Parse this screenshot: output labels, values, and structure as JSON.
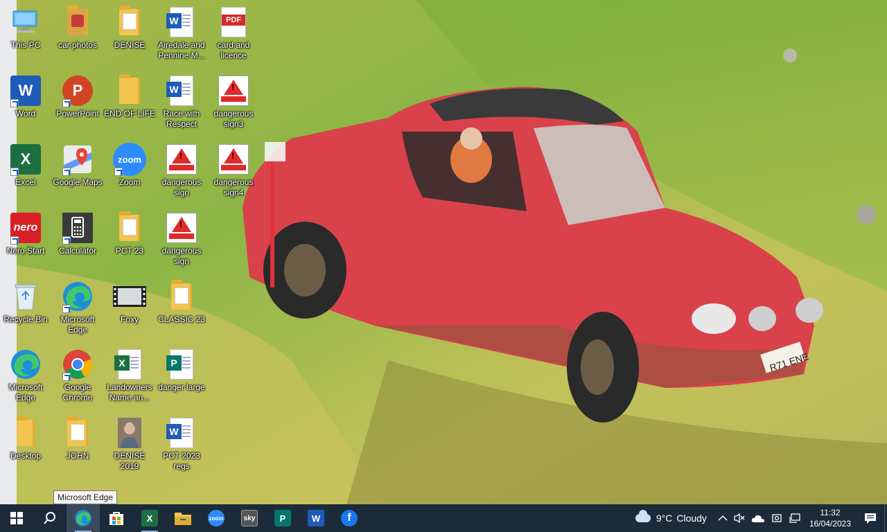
{
  "desktop": {
    "icons": [
      {
        "label": "This PC"
      },
      {
        "label": "car photos"
      },
      {
        "label": "DENISE"
      },
      {
        "label": "Airedale and Pennine M..."
      },
      {
        "label": "card and licence"
      },
      {
        "label": "Word"
      },
      {
        "label": "PowerPoint"
      },
      {
        "label": "END OF LIFE"
      },
      {
        "label": "Race with Respect"
      },
      {
        "label": "dangerous sign3"
      },
      {
        "label": "Excel"
      },
      {
        "label": "Google Maps"
      },
      {
        "label": "Zoom"
      },
      {
        "label": "dangerous sign"
      },
      {
        "label": "dangerous sign4"
      },
      {
        "label": "Nero Start"
      },
      {
        "label": "Calculator"
      },
      {
        "label": "PCT 23"
      },
      {
        "label": "dangerous sign"
      },
      {
        "label": "Recycle Bin"
      },
      {
        "label": "Microsoft Edge"
      },
      {
        "label": "Foxy"
      },
      {
        "label": "CLASSIC 23"
      },
      {
        "label": "Microsoft Edge"
      },
      {
        "label": "Google Chrome"
      },
      {
        "label": "Landowners Name an..."
      },
      {
        "label": "danger large"
      },
      {
        "label": "Desktop"
      },
      {
        "label": "JOHN"
      },
      {
        "label": "DENISE 2019"
      },
      {
        "label": "PCT 2023 regs"
      }
    ],
    "pdf_badge": "PDF",
    "zoom_badge": "zoom",
    "nero_badge": "nero",
    "licence_plate": "R71 ENE"
  },
  "tooltip": {
    "text": "Microsoft Edge"
  },
  "taskbar": {
    "pinned": [
      {
        "name": "Start",
        "icon": "windows-logo-icon"
      },
      {
        "name": "Search",
        "icon": "search-icon"
      },
      {
        "name": "Microsoft Edge",
        "icon": "edge-icon"
      },
      {
        "name": "Microsoft Store",
        "icon": "store-icon"
      },
      {
        "name": "Excel",
        "icon": "excel-icon",
        "glyph": "X"
      },
      {
        "name": "File Explorer",
        "icon": "folder-icon"
      },
      {
        "name": "Zoom",
        "icon": "zoom-icon",
        "glyph": "zoom"
      },
      {
        "name": "Sky",
        "icon": "sky-icon",
        "glyph": "sky"
      },
      {
        "name": "Publisher",
        "icon": "publisher-icon",
        "glyph": "P"
      },
      {
        "name": "Word",
        "icon": "word-icon",
        "glyph": "W"
      },
      {
        "name": "Facebook",
        "icon": "facebook-icon",
        "glyph": "f"
      }
    ],
    "weather": {
      "temp": "9°C",
      "condition": "Cloudy"
    },
    "clock": {
      "time": "11:32",
      "date": "16/04/2023"
    }
  },
  "colors": {
    "taskbar_bg": "#1c2b3a",
    "word": "#1f5bb8",
    "excel": "#1d6f42",
    "powerpoint": "#d04423",
    "zoom": "#2d8cff",
    "facebook": "#1877f2",
    "car_red": "#d9424a"
  }
}
